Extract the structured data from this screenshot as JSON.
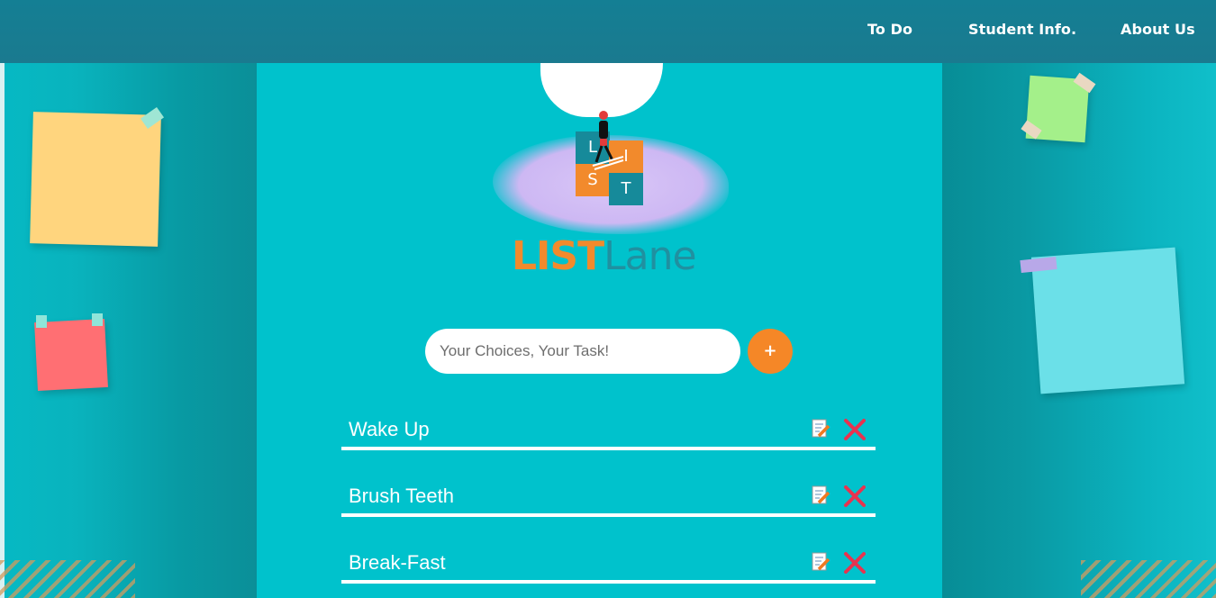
{
  "nav": {
    "items": [
      {
        "label": "To Do"
      },
      {
        "label": "Student Info."
      },
      {
        "label": "About Us"
      }
    ]
  },
  "logo": {
    "blocks": [
      "L",
      "I",
      "S",
      "T"
    ],
    "brand_list": "LIST",
    "brand_lane": "Lane"
  },
  "task_input": {
    "placeholder": "Your Choices, Your Task!",
    "value": ""
  },
  "add_button": {
    "label": "+"
  },
  "tasks": [
    {
      "label": "Wake Up"
    },
    {
      "label": "Brush Teeth"
    },
    {
      "label": "Break-Fast"
    }
  ],
  "icons": {
    "edit": "edit-note-icon",
    "delete": "close-x-icon"
  },
  "colors": {
    "nav_bg": "#147f94",
    "page_bg": "#00c2cc",
    "accent_orange": "#f58727",
    "delete_red": "#e8334f",
    "brand_teal": "#2090a0"
  }
}
